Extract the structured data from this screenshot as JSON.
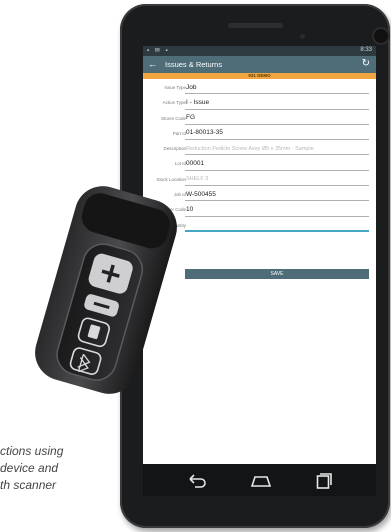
{
  "app": {
    "status_time": "8:33",
    "status_icons": "▪ ✉ ▪",
    "title": "Issues & Returns",
    "banner": "931 DEMO",
    "back_glyph": "←",
    "refresh_glyph": "↻"
  },
  "form": {
    "fields": [
      {
        "label": "Issue Type",
        "value": "Job"
      },
      {
        "label": "Action Type",
        "value": "I - Issue"
      },
      {
        "label": "Stores Code",
        "value": "FG"
      },
      {
        "label": "Part Id",
        "value": "01-80013-35"
      },
      {
        "label": "Description",
        "value": "Reduction Pedicle Screw Assy Ø5 x 35mm - Sample"
      },
      {
        "label": "Lot Id",
        "value": "00001"
      },
      {
        "label": "Stock Location",
        "value": "SHELF 3"
      },
      {
        "label": "Job Id",
        "value": "W-500455"
      },
      {
        "label": "Oper Code",
        "value": "10"
      },
      {
        "label": "Quantity",
        "value": ""
      }
    ],
    "save_label": "SAVE"
  },
  "caption": {
    "line1": "ctions using",
    "line2": "device and",
    "line3": "th scanner"
  },
  "icons": {
    "scanner_plus": "plus-icon",
    "scanner_minus": "minus-icon",
    "scanner_page": "page-icon",
    "scanner_bluetooth": "bluetooth-icon"
  }
}
